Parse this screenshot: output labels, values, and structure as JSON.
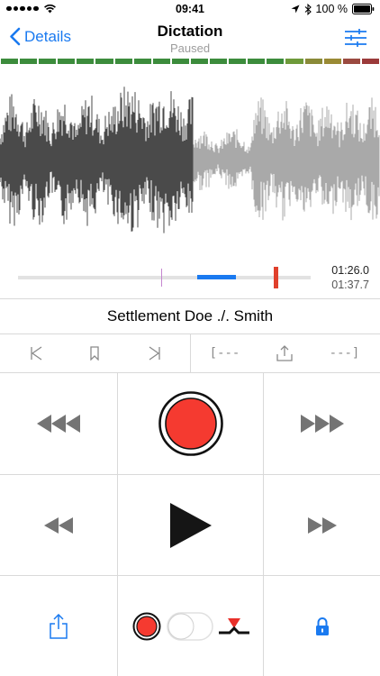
{
  "status_bar": {
    "time": "09:41",
    "battery": "100 %"
  },
  "nav": {
    "back_label": "Details",
    "title": "Dictation",
    "subtitle": "Paused"
  },
  "level_meter_colors": [
    "#3c8c3c",
    "#3c8c3c",
    "#3c8c3c",
    "#3c8c3c",
    "#3c8c3c",
    "#3c8c3c",
    "#3c8c3c",
    "#3c8c3c",
    "#3c8c3c",
    "#3c8c3c",
    "#3c8c3c",
    "#3c8c3c",
    "#3c8c3c",
    "#3c8c3c",
    "#3c8c3c",
    "#6e9a3a",
    "#8a8a38",
    "#9a8a34",
    "#9b4a40",
    "#9b3a3a"
  ],
  "timeline": {
    "current_time": "01:26.0",
    "total_time": "01:37.7"
  },
  "recording": {
    "title": "Settlement Doe ./. Smith"
  },
  "edit_controls": {
    "mark_start": "[---",
    "mark_end": "---]"
  },
  "icons": {
    "back": "chevron-left-icon",
    "settings": "sliders-icon",
    "jump_start": "skip-start-icon",
    "bookmark": "bookmark-icon",
    "jump_end": "skip-end-icon",
    "upload": "upload-icon",
    "fast_rewind": "fast-rewind-icon",
    "record": "record-icon",
    "fast_forward": "fast-forward-icon",
    "rewind": "rewind-icon",
    "play": "play-icon",
    "forward": "forward-icon",
    "share": "share-icon",
    "lock": "lock-icon"
  },
  "colors": {
    "accent": "#1a7af0",
    "record": "#f53a30",
    "playhead": "#e0402c"
  }
}
